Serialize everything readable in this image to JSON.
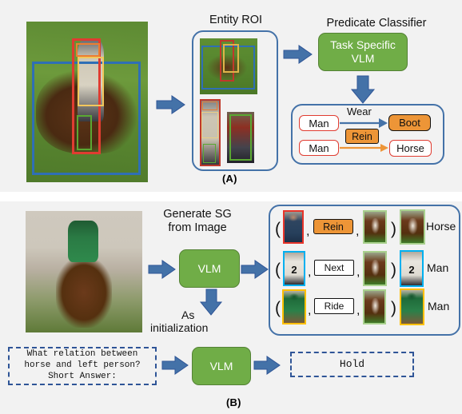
{
  "figure": {
    "panel_a_label": "(A)",
    "panel_b_label": "(B)"
  },
  "panel_a": {
    "entity_roi_title": "Entity ROI",
    "predicate_classifier_title": "Predicate Classifier",
    "vlm_box_label": "Task Specific\nVLM",
    "vlm_box_line1": "Task Specific",
    "vlm_box_line2": "VLM",
    "scene_graph": {
      "relations": [
        {
          "subject": "Man",
          "predicate": "Wear",
          "object": "Boot",
          "predicate_style": "label-on-arrow",
          "arrow_color": "#4472a8",
          "object_style": "orange"
        },
        {
          "subject": "Man",
          "predicate": "Rein",
          "object": "Horse",
          "predicate_style": "box-on-arrow",
          "arrow_color": "#ed9537",
          "object_style": "white"
        }
      ]
    },
    "colors": {
      "green": "#70ad47",
      "blue_arrow": "#4472a8",
      "orange": "#ed9537",
      "node_border_red": "#e03c31",
      "panel_border": "#4472a8"
    },
    "boxes_in_image": [
      {
        "name": "person-red-box",
        "color": "#e03c31"
      },
      {
        "name": "horse-blue-box",
        "color": "#2f6fb5"
      },
      {
        "name": "helmet-orange-box",
        "color": "#ed7d31"
      },
      {
        "name": "jacket-yellow-box",
        "color": "#f2c75c"
      },
      {
        "name": "boot-green-box",
        "color": "#5aa832"
      }
    ]
  },
  "panel_b": {
    "generate_sg_title_line1": "Generate SG",
    "generate_sg_title_line2": "from Image",
    "vlm_top_label": "VLM",
    "vlm_bottom_label": "VLM",
    "as_initialization_line1": "As",
    "as_initialization_line2": "initialization",
    "question_prompt": "What relation between\nhorse and left person?\nShort Answer:",
    "answer": "Hold",
    "triplets": [
      {
        "subject_thumb": "person-red",
        "subject_color": "#e8342a",
        "predicate": "Rein",
        "predicate_style": "orange",
        "object_thumb": "horse-green",
        "object_color": "#a9d18e",
        "result_thumb": "horse-green",
        "result_color": "#a9d18e",
        "result_label": "Horse"
      },
      {
        "subject_thumb": "man-cyan",
        "subject_color": "#00b0f0",
        "predicate": "Next",
        "predicate_style": "white",
        "object_thumb": "horse-green",
        "object_color": "#a9d18e",
        "result_thumb": "man-cyan",
        "result_color": "#00b0f0",
        "result_label": "Man"
      },
      {
        "subject_thumb": "jockey-gold",
        "subject_color": "#ffc000",
        "predicate": "Ride",
        "predicate_style": "white",
        "object_thumb": "horse-green",
        "object_color": "#a9d18e",
        "result_thumb": "jockey-gold",
        "result_color": "#ffc000",
        "result_label": "Man"
      }
    ],
    "punctuation": {
      "open_paren": "(",
      "close_paren": ")",
      "comma": ","
    }
  }
}
